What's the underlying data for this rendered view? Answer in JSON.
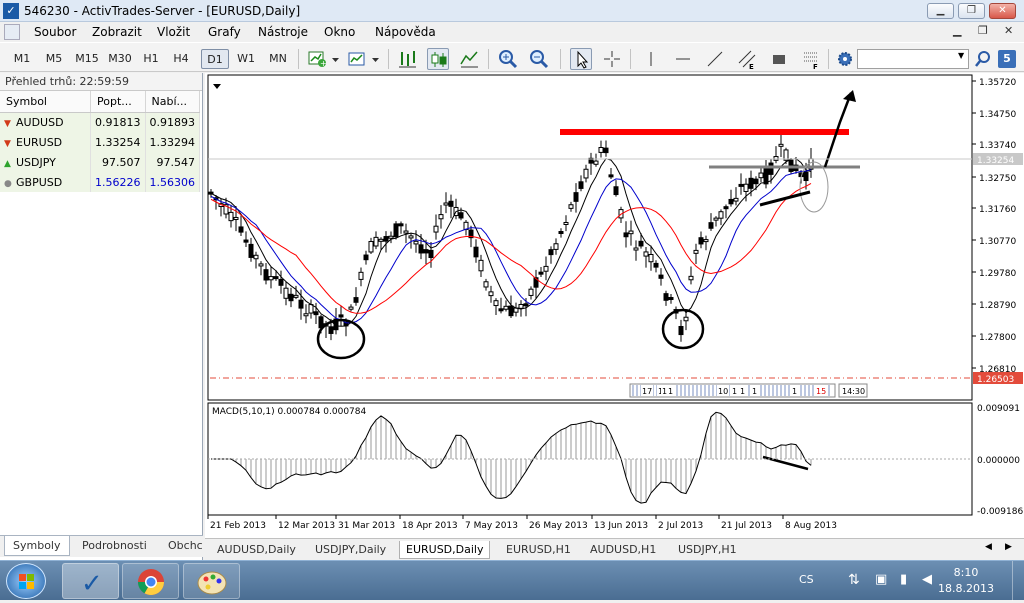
{
  "window": {
    "title": "546230 - ActivTrades-Server - [EURUSD,Daily]"
  },
  "menu": [
    "Soubor",
    "Zobrazit",
    "Vložit",
    "Grafy",
    "Nástroje",
    "Okno",
    "Nápověda"
  ],
  "timeframes": [
    "M1",
    "M5",
    "M15",
    "M30",
    "H1",
    "H4",
    "D1",
    "W1",
    "MN"
  ],
  "active_timeframe": "D1",
  "toolbar": {
    "search_badge": "5"
  },
  "market_watch": {
    "title": "Přehled trhů: 22:59:59",
    "headers": [
      "Symbol",
      "Popt...",
      "Nabí..."
    ],
    "rows": [
      {
        "symbol": "AUDUSD",
        "bid": "0.91813",
        "ask": "0.91893",
        "dir": "down",
        "color": "#000000"
      },
      {
        "symbol": "EURUSD",
        "bid": "1.33254",
        "ask": "1.33294",
        "dir": "down",
        "color": "#000000"
      },
      {
        "symbol": "USDJPY",
        "bid": "97.507",
        "ask": "97.547",
        "dir": "up",
        "color": "#000000"
      },
      {
        "symbol": "GBPUSD",
        "bid": "1.56226",
        "ask": "1.56306",
        "dir": "neutral",
        "color": "#0000cc"
      }
    ],
    "tabs": [
      "Symboly",
      "Podrobnosti",
      "Obchc"
    ]
  },
  "chart": {
    "price_labels": [
      "1.35720",
      "1.34750",
      "1.33740",
      "1.33254",
      "1.32750",
      "1.31760",
      "1.30770",
      "1.29780",
      "1.28790",
      "1.27800",
      "1.26810",
      "1.26503"
    ],
    "current_price": "1.33254",
    "alert_price": "1.26503",
    "macd_label": "MACD(5,10,1) 0.000784 0.000784",
    "macd_ticks": [
      "0.009091",
      "0.000000",
      "-0.009186"
    ],
    "date_labels": [
      "21 Feb 2013",
      "12 Mar 2013",
      "31 Mar 2013",
      "18 Apr 2013",
      "7 May 2013",
      "26 May 2013",
      "13 Jun 2013",
      "2 Jul 2013",
      "21 Jul 2013",
      "8 Aug 2013"
    ],
    "scale_nums": [
      "17",
      "1",
      "1",
      "1",
      "10",
      "1",
      "1",
      "1",
      "1",
      "15"
    ],
    "time_label": "14:30",
    "colors": {
      "resistance": "#ff0000",
      "ma_black": "#000000",
      "ma_blue": "#0000cc",
      "ma_red": "#ff0000",
      "neckline": "#808080"
    }
  },
  "chart_tabs": [
    "AUDUSD,Daily",
    "USDJPY,Daily",
    "EURUSD,Daily",
    "EURUSD,H1",
    "AUDUSD,H1",
    "USDJPY,H1"
  ],
  "active_chart_tab": "EURUSD,Daily",
  "taskbar": {
    "lang": "CS",
    "time": "8:10",
    "date": "18.8.2013"
  }
}
